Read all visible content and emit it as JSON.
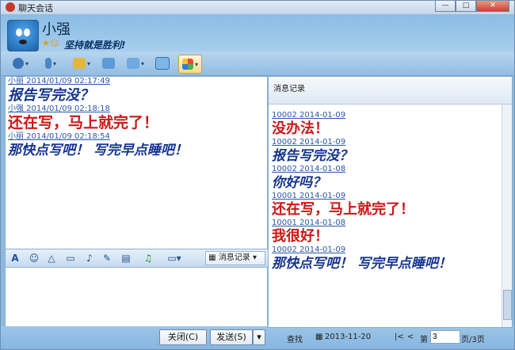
{
  "window": {
    "title": "聊天会话",
    "controls": [
      "—",
      "□",
      "✕"
    ]
  },
  "profile": {
    "name": "小强",
    "status_icons": "★☺",
    "signature": "坚持就是胜利!"
  },
  "toolbar": [
    {
      "icon": "camera-icon"
    },
    {
      "icon": "microphone-icon"
    },
    {
      "icon": "folder-icon"
    },
    {
      "icon": "message-icon"
    },
    {
      "icon": "screen-icon"
    },
    {
      "icon": "monitor-icon"
    },
    {
      "icon": "apps-icon"
    }
  ],
  "conversation": [
    {
      "sender": "小丽   2014/01/09  02:17:49",
      "text": "报告写完没？",
      "style": "m0"
    },
    {
      "sender": "小强   2014/01/09  02:18:18",
      "text": "还在写，马上就完了！",
      "style": "m1"
    },
    {
      "sender": "小丽   2014/01/09  02:18:54",
      "text": "那快点写吧！ 写完早点睡吧！",
      "style": "m2"
    }
  ],
  "format_bar": {
    "font_label": "A",
    "history_button": "消息记录",
    "icons": [
      "font-icon",
      "emoji-icon",
      "shake-icon",
      "screenshot-icon",
      "voice-icon",
      "paste-icon",
      "image-icon",
      "music-icon",
      "screen-share-icon"
    ]
  },
  "buttons": {
    "close": "关闭(C)",
    "send": "发送(S)"
  },
  "history": {
    "title": "消息记录",
    "items": [
      {
        "head": "10002   2014-01-09",
        "text": "没办法！",
        "cls": "rb-red"
      },
      {
        "head": "10002   2014-01-09",
        "text": "报告写完没？",
        "cls": "rb-blue"
      },
      {
        "head": "10002   2014-01-08",
        "text": "你好吗？",
        "cls": "rb-blue"
      },
      {
        "head": "10001   2014-01-09",
        "text": "还在写，马上就完了！",
        "cls": "rb-red"
      },
      {
        "head": "10001   2014-01-08",
        "text": "我很好！",
        "cls": "rb-red"
      },
      {
        "head": "10002   2014-01-09",
        "text": "那快点写吧！ 写完早点睡吧！",
        "cls": "rb-blue"
      }
    ]
  },
  "pager": {
    "search": "查找",
    "date": "2013-11-20",
    "first": "|<",
    "prev": "<",
    "page_prefix": "第",
    "page_value": "3",
    "page_suffix": "页/3页"
  }
}
